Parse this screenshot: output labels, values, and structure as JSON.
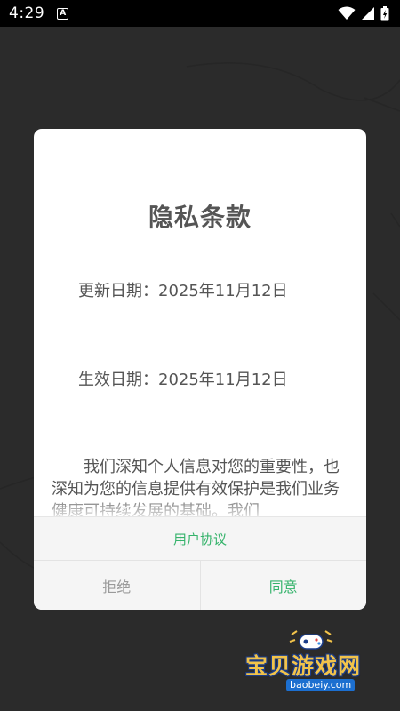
{
  "status_bar": {
    "time": "4:29",
    "notification_letter": "A"
  },
  "dialog": {
    "title": "隐私条款",
    "updated_date": "更新日期：2025年11月12日",
    "effective_date": "生效日期：2025年11月12日",
    "body": "我们深知个人信息对您的重要性，也深知为您的信息提供有效保护是我们业务健康可持续发展的基础。我们",
    "user_agreement_link": "用户协议",
    "reject_button": "拒绝",
    "agree_button": "同意"
  },
  "watermark": {
    "brand": "宝贝游戏网",
    "url": "baobeiy.com"
  },
  "colors": {
    "accent_green": "#35b36b",
    "background": "#2b2b2b",
    "status_bar": "#000000"
  }
}
